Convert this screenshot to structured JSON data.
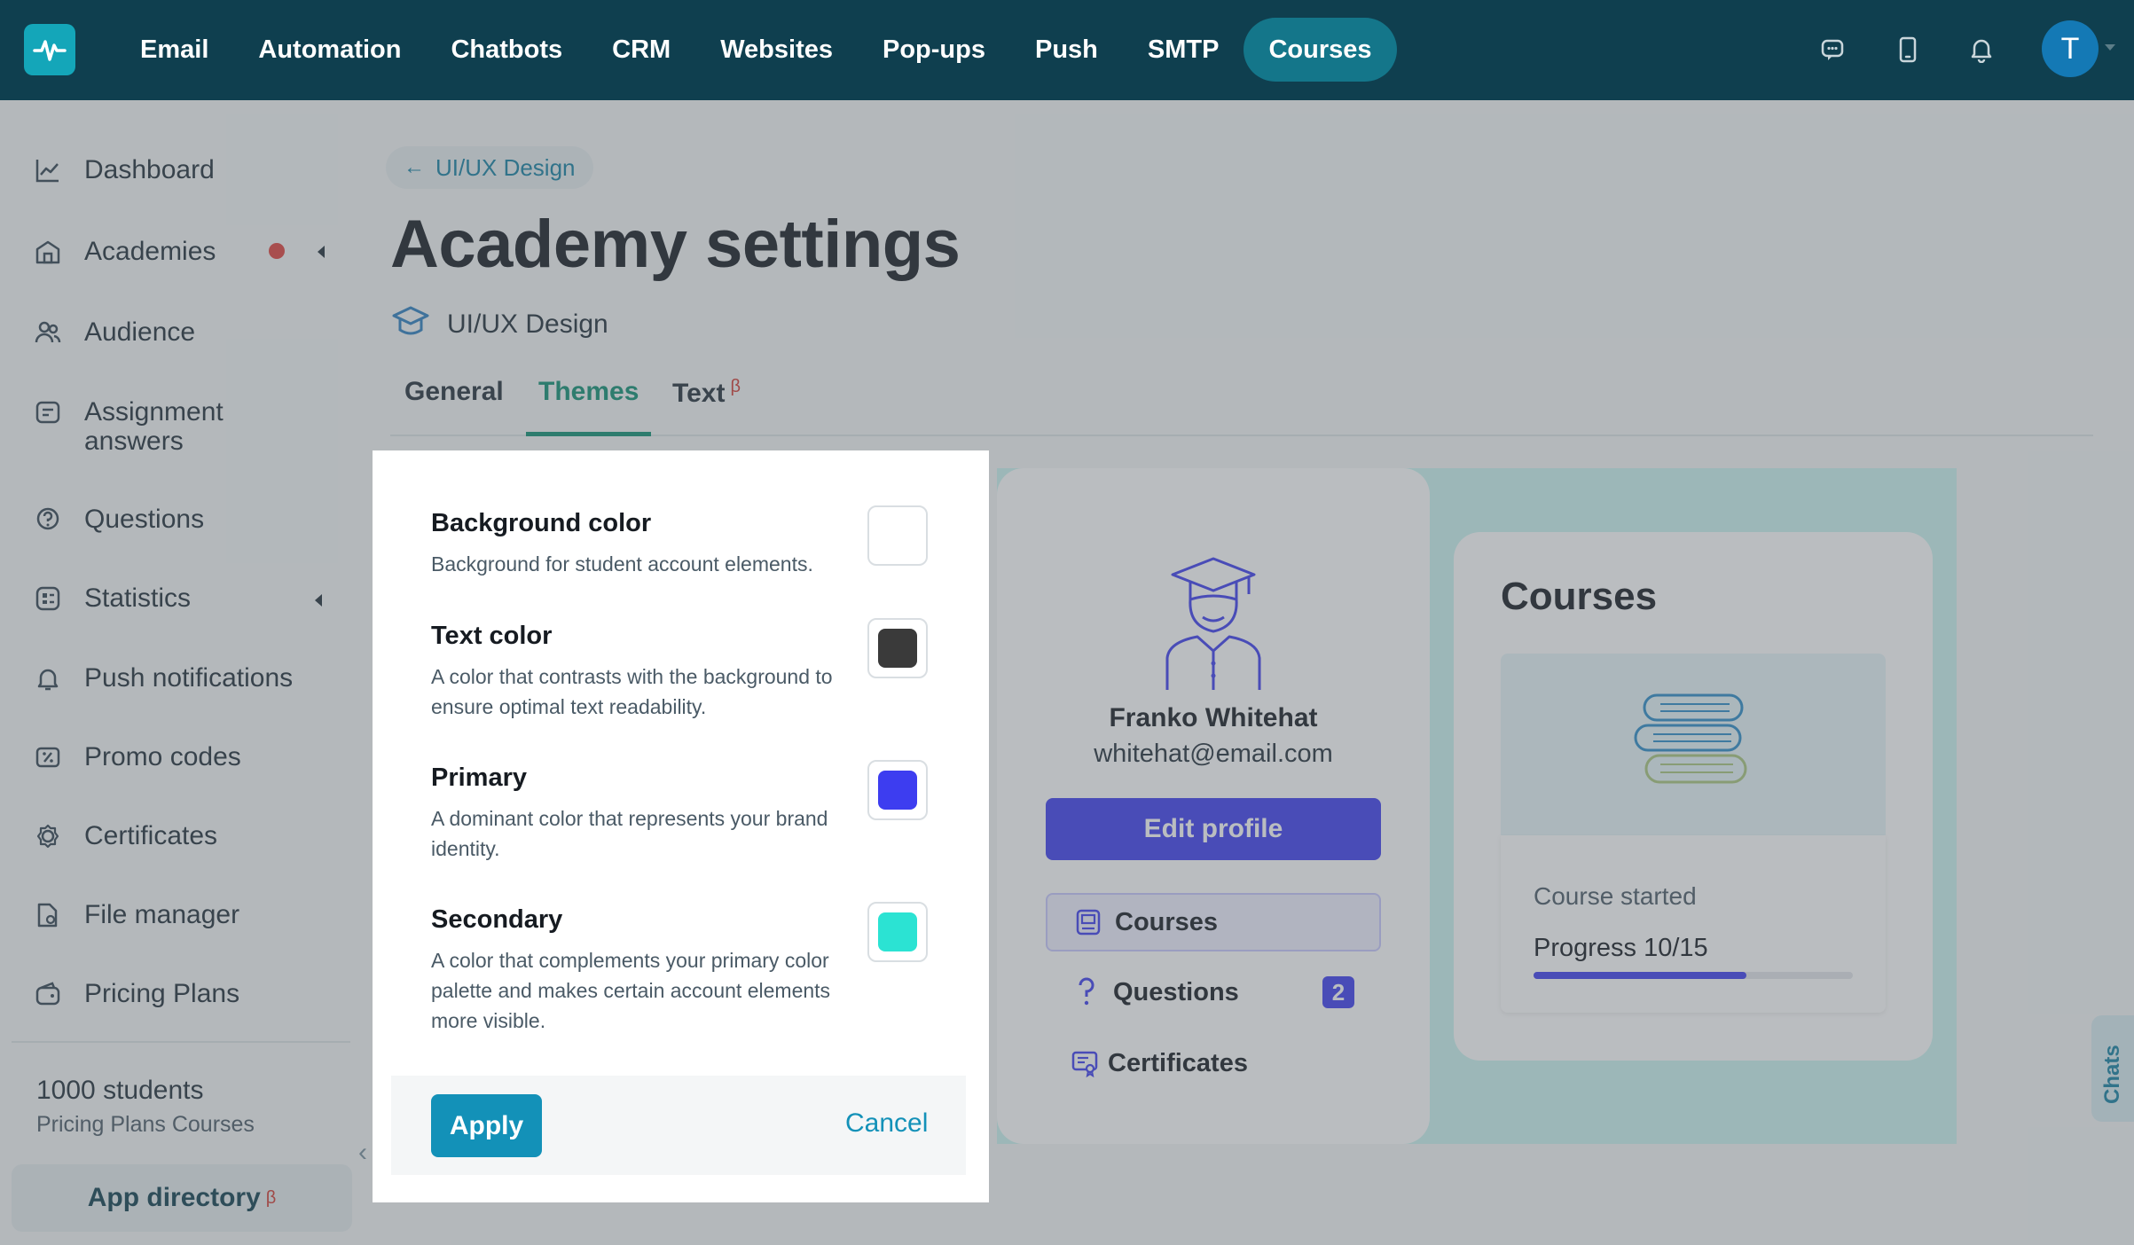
{
  "topnav": {
    "items": [
      "Email",
      "Automation",
      "Chatbots",
      "CRM",
      "Websites",
      "Pop-ups",
      "Push",
      "SMTP",
      "Courses"
    ],
    "active": "Courses",
    "avatar_initial": "T",
    "icons": [
      "chat-icon",
      "mobile-icon",
      "bell-icon"
    ]
  },
  "sidebar": {
    "items": [
      {
        "label": "Dashboard",
        "icon": "chart-line-icon"
      },
      {
        "label": "Academies",
        "icon": "building-icon"
      },
      {
        "label": "Audience",
        "icon": "people-icon"
      },
      {
        "label": "Assignment answers",
        "icon": "assignment-icon"
      },
      {
        "label": "Questions",
        "icon": "question-icon"
      },
      {
        "label": "Statistics",
        "icon": "stats-icon"
      },
      {
        "label": "Push notifications",
        "icon": "bell-icon"
      },
      {
        "label": "Promo codes",
        "icon": "promo-icon"
      },
      {
        "label": "Certificates",
        "icon": "certificate-icon"
      },
      {
        "label": "File manager",
        "icon": "file-icon"
      },
      {
        "label": "Pricing Plans",
        "icon": "wallet-icon"
      }
    ],
    "plan_title": "1000 students",
    "plan_subtitle": "Pricing Plans Courses",
    "app_directory": "App directory",
    "beta_mark": "β"
  },
  "main": {
    "breadcrumb": "UI/UX Design",
    "title": "Academy settings",
    "academy_name": "UI/UX Design",
    "tabs": [
      {
        "label": "General"
      },
      {
        "label": "Themes"
      },
      {
        "label": "Text"
      }
    ],
    "active_tab": "Themes",
    "text_tab_beta": "β"
  },
  "modal": {
    "settings": [
      {
        "title": "Background color",
        "description": "Background for student account elements.",
        "color": "#ffffff"
      },
      {
        "title": "Text color",
        "description": "A color that contrasts with the background to ensure optimal text readability.",
        "color": "#3a3a3a"
      },
      {
        "title": "Primary",
        "description": "A dominant color that represents your brand identity.",
        "color": "#3d3df0"
      },
      {
        "title": "Secondary",
        "description": "A color that complements your primary color palette and makes certain account elements more visible.",
        "color": "#2be3d3"
      }
    ],
    "apply_label": "Apply",
    "cancel_label": "Cancel"
  },
  "preview": {
    "name": "Franko Whitehat",
    "email": "whitehat@email.com",
    "edit_profile": "Edit profile",
    "menu": [
      {
        "label": "Courses"
      },
      {
        "label": "Questions",
        "count": "2"
      },
      {
        "label": "Certificates"
      }
    ],
    "courses_title": "Courses",
    "course_status": "Course started",
    "course_progress": "Progress 10/15",
    "progress_fraction": 0.6667,
    "chats_label": "Chats"
  }
}
